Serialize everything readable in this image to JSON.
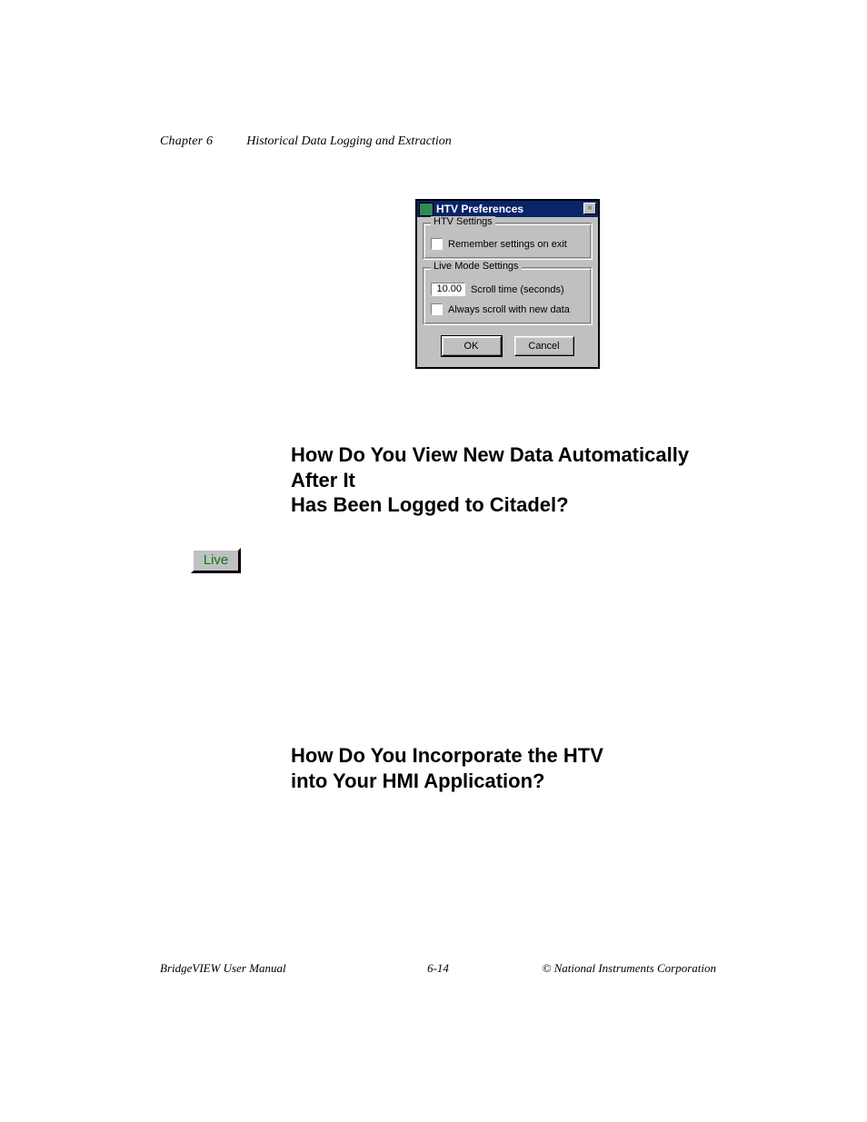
{
  "header": {
    "chapter": "Chapter 6",
    "title": "Historical Data Logging and Extraction"
  },
  "dialog": {
    "title": "HTV Preferences",
    "close_glyph": "×",
    "group1": {
      "label": "HTV Settings",
      "remember_label": "Remember settings on exit"
    },
    "group2": {
      "label": "Live Mode Settings",
      "scroll_value": "10.00",
      "scroll_label": "Scroll time (seconds)",
      "always_label": "Always scroll with new data"
    },
    "ok_label": "OK",
    "cancel_label": "Cancel"
  },
  "heading1_line1": "How Do You View New Data Automatically After It",
  "heading1_line2": "Has Been Logged to Citadel?",
  "live_button": "Live",
  "heading2_line1": "How Do You Incorporate the HTV",
  "heading2_line2": "into Your HMI Application?",
  "footer": {
    "left": "BridgeVIEW User Manual",
    "center": "6-14",
    "right": "© National Instruments Corporation"
  }
}
